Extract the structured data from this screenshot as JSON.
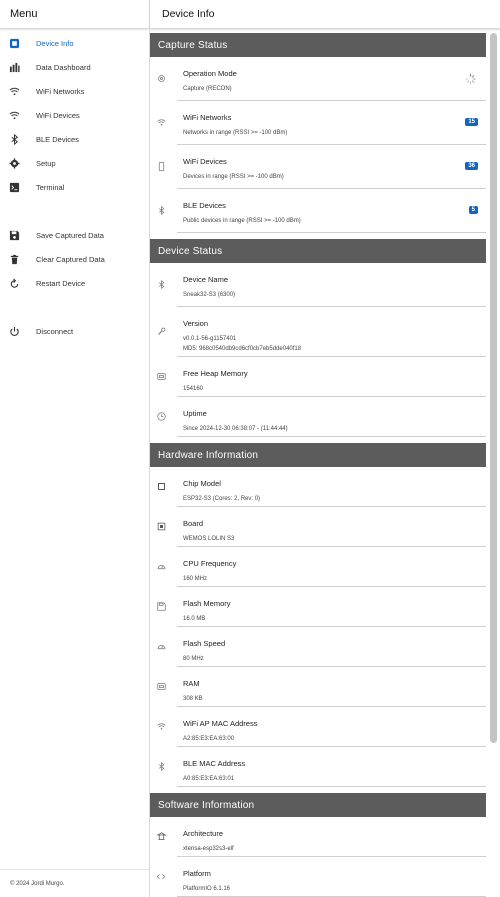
{
  "sidebar": {
    "header": "Menu",
    "items": [
      {
        "label": "Device Info",
        "icon": "device-info-icon",
        "active": true
      },
      {
        "label": "Data Dashboard",
        "icon": "bar-chart-icon"
      },
      {
        "label": "WiFi Networks",
        "icon": "wifi-icon"
      },
      {
        "label": "WiFi Devices",
        "icon": "wifi-icon"
      },
      {
        "label": "BLE Devices",
        "icon": "bluetooth-icon"
      },
      {
        "label": "Setup",
        "icon": "gear-icon"
      },
      {
        "label": "Terminal",
        "icon": "terminal-icon"
      },
      {
        "label": "Save Captured Data",
        "icon": "save-icon"
      },
      {
        "label": "Clear Captured Data",
        "icon": "trash-icon"
      },
      {
        "label": "Restart Device",
        "icon": "restart-icon"
      },
      {
        "label": "Disconnect",
        "icon": "power-icon"
      }
    ],
    "footer": "© 2024 Jordi Murgo."
  },
  "header": {
    "title": "Device Info"
  },
  "sections": {
    "capture": {
      "title": "Capture Status",
      "operation_mode": {
        "title": "Operation Mode",
        "sub": "Capture (RECON)"
      },
      "wifi_networks": {
        "title": "WiFi Networks",
        "sub": "Networks in range (RSSI >= -100 dBm)",
        "count": "15"
      },
      "wifi_devices": {
        "title": "WiFi Devices",
        "sub": "Devices in range (RSSI >= -100 dBm)",
        "count": "36"
      },
      "ble_devices": {
        "title": "BLE Devices",
        "sub": "Public devices in range (RSSI >= -100 dBm)",
        "count": "5"
      }
    },
    "device": {
      "title": "Device Status",
      "name": {
        "title": "Device Name",
        "sub": "Sneak32-S3 (6300)"
      },
      "version": {
        "title": "Version",
        "sub1": "v0.0.1-56-g1157401",
        "sub2": "MD5: 968c0540db9cd6cf0cb7eb5dde040f18"
      },
      "heap": {
        "title": "Free Heap Memory",
        "sub": "154160"
      },
      "uptime": {
        "title": "Uptime",
        "sub": "Since 2024-12-30 06:38:07 - (11:44:44)"
      }
    },
    "hardware": {
      "title": "Hardware Information",
      "chip": {
        "title": "Chip Model",
        "sub": "ESP32-S3 (Cores: 2, Rev: 0)"
      },
      "board": {
        "title": "Board",
        "sub": "WEMOS LOLIN S3"
      },
      "cpu": {
        "title": "CPU Frequency",
        "sub": "160 MHz"
      },
      "flash_mem": {
        "title": "Flash Memory",
        "sub": "16.0 MB"
      },
      "flash_speed": {
        "title": "Flash Speed",
        "sub": "80 MHz"
      },
      "ram": {
        "title": "RAM",
        "sub": "308 KB"
      },
      "wifi_mac": {
        "title": "WiFi AP MAC Address",
        "sub": "A2:85:E3:EA:63:00"
      },
      "ble_mac": {
        "title": "BLE MAC Address",
        "sub": "A0:85:E3:EA:63:01"
      }
    },
    "software": {
      "title": "Software Information",
      "arch": {
        "title": "Architecture",
        "sub": "xtensa-esp32s3-elf"
      },
      "platform": {
        "title": "Platform",
        "sub": "PlatformIO 6.1.16"
      }
    }
  },
  "colors": {
    "accent": "#1565c0",
    "section_header": "#5c5c5c"
  }
}
